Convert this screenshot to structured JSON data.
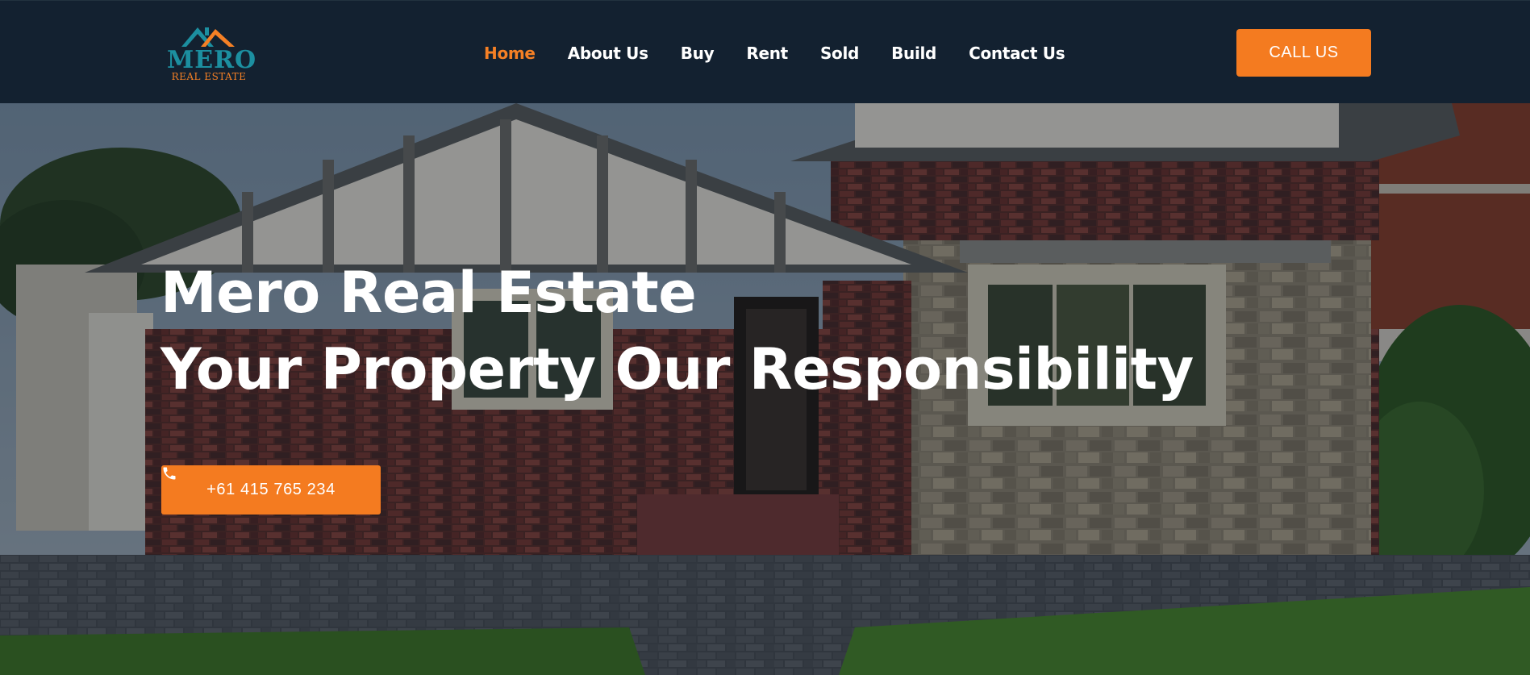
{
  "header": {
    "logo": {
      "line1": "MERO",
      "line2": "REAL ESTATE",
      "teal": "#1c8fa0",
      "orange": "#f58025"
    },
    "nav": [
      {
        "label": "Home",
        "active": true
      },
      {
        "label": "About Us"
      },
      {
        "label": "Buy"
      },
      {
        "label": "Rent"
      },
      {
        "label": "Sold"
      },
      {
        "label": "Build"
      },
      {
        "label": "Contact Us"
      }
    ],
    "cta_label": "CALL US",
    "background": "#132130",
    "accent": "#f47b20"
  },
  "hero": {
    "title_line1": "Mero Real Estate",
    "title_line2": "Your Property Our Responsibility",
    "phone_label": "+61 415 765 234",
    "phone_icon": "phone-icon",
    "background_image": "brick-bungalow-house-photo"
  }
}
